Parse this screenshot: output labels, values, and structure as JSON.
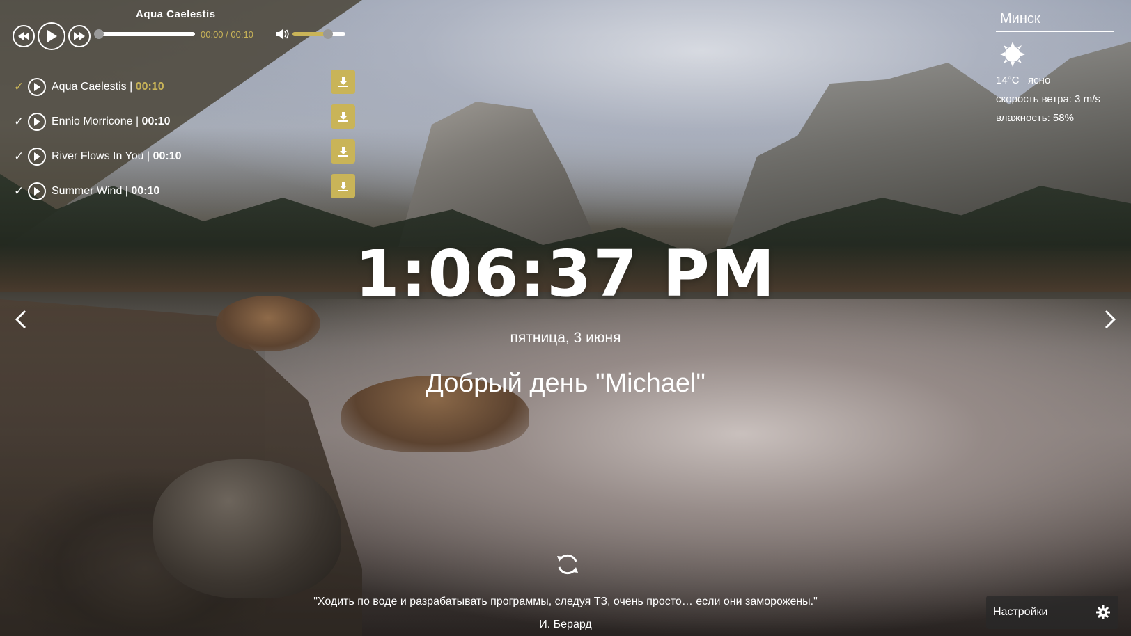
{
  "player": {
    "current_title": "Aqua Caelestis",
    "time": "00:00 / 00:10",
    "volume_level": 0.64,
    "progress": 0,
    "icons": {
      "prev": "rewind-icon",
      "play": "play-icon",
      "next": "fast-forward-icon",
      "volume": "speaker-icon"
    }
  },
  "playlist": [
    {
      "title": "Aqua Caelestis",
      "separator": " | ",
      "duration": "00:10",
      "checked": "✓",
      "active": true
    },
    {
      "title": "Ennio Morricone",
      "separator": " | ",
      "duration": "00:10",
      "checked": "✓",
      "active": false
    },
    {
      "title": "River Flows In You",
      "separator": " | ",
      "duration": "00:10",
      "checked": "✓",
      "active": false
    },
    {
      "title": "Summer Wind",
      "separator": " | ",
      "duration": "00:10",
      "checked": "✓",
      "active": false
    }
  ],
  "weather": {
    "city": "Минск",
    "temperature": "14°C",
    "description": "ясно",
    "wind": "скорость ветра: 3 m/s",
    "humidity": "влажность: 58%",
    "icon": "sun-icon"
  },
  "clock": {
    "time": "1:06:37 PM",
    "date": "пятница, 3 июня"
  },
  "greeting": "Добрый день  \"Michael\"",
  "quote": {
    "text": "\"Ходить по воде и разрабатывать программы, следуя ТЗ, очень просто… если они заморожены.\"",
    "author": "И. Берард"
  },
  "settings": {
    "label": "Настройки",
    "icon": "gear-icon"
  },
  "colors": {
    "accent": "#c9b458"
  }
}
